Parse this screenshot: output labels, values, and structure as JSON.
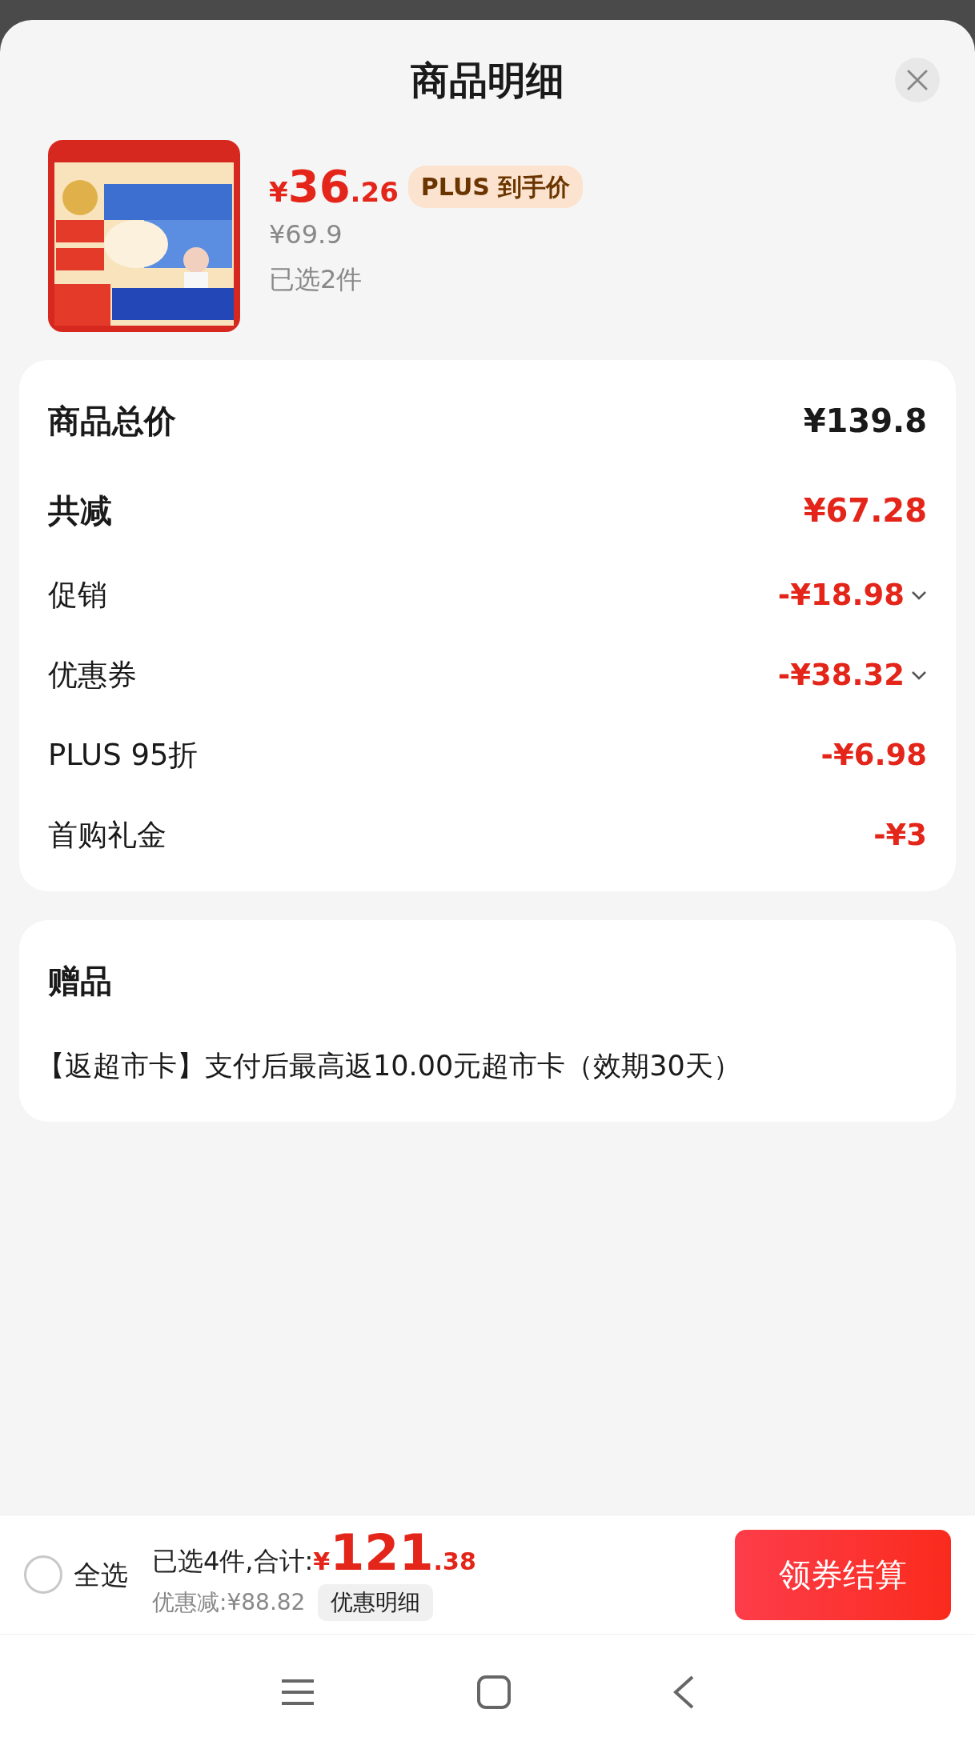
{
  "sheet": {
    "title": "商品明细"
  },
  "product": {
    "price_symbol": "¥",
    "price_int": "36",
    "price_dec": ".26",
    "badge": "PLUS 到手价",
    "original_price": "¥69.9",
    "selected_count": "已选2件"
  },
  "summary": {
    "rows": [
      {
        "label": "商品总价",
        "value": "¥139.8",
        "kind": "total"
      },
      {
        "label": "共减",
        "value": "¥67.28",
        "kind": "reduction"
      },
      {
        "label": "促销",
        "value": "-¥18.98",
        "kind": "expandable"
      },
      {
        "label": "优惠券",
        "value": "-¥38.32",
        "kind": "expandable"
      },
      {
        "label": "PLUS 95折",
        "value": "-¥6.98",
        "kind": "discount"
      },
      {
        "label": "首购礼金",
        "value": "-¥3",
        "kind": "discount"
      }
    ]
  },
  "gifts": {
    "title": "赠品",
    "items": [
      "【返超市卡】支付后最高返10.00元超市卡（效期30天）"
    ]
  },
  "footer": {
    "select_all": {
      "label": "全选",
      "checked": false
    },
    "summary": "已选4件,合计:",
    "total_symbol": "¥",
    "total_int": "121",
    "total_dec": ".38",
    "saving": "优惠减:¥88.82",
    "details_button": "优惠明细",
    "checkout_button": "领券结算"
  }
}
